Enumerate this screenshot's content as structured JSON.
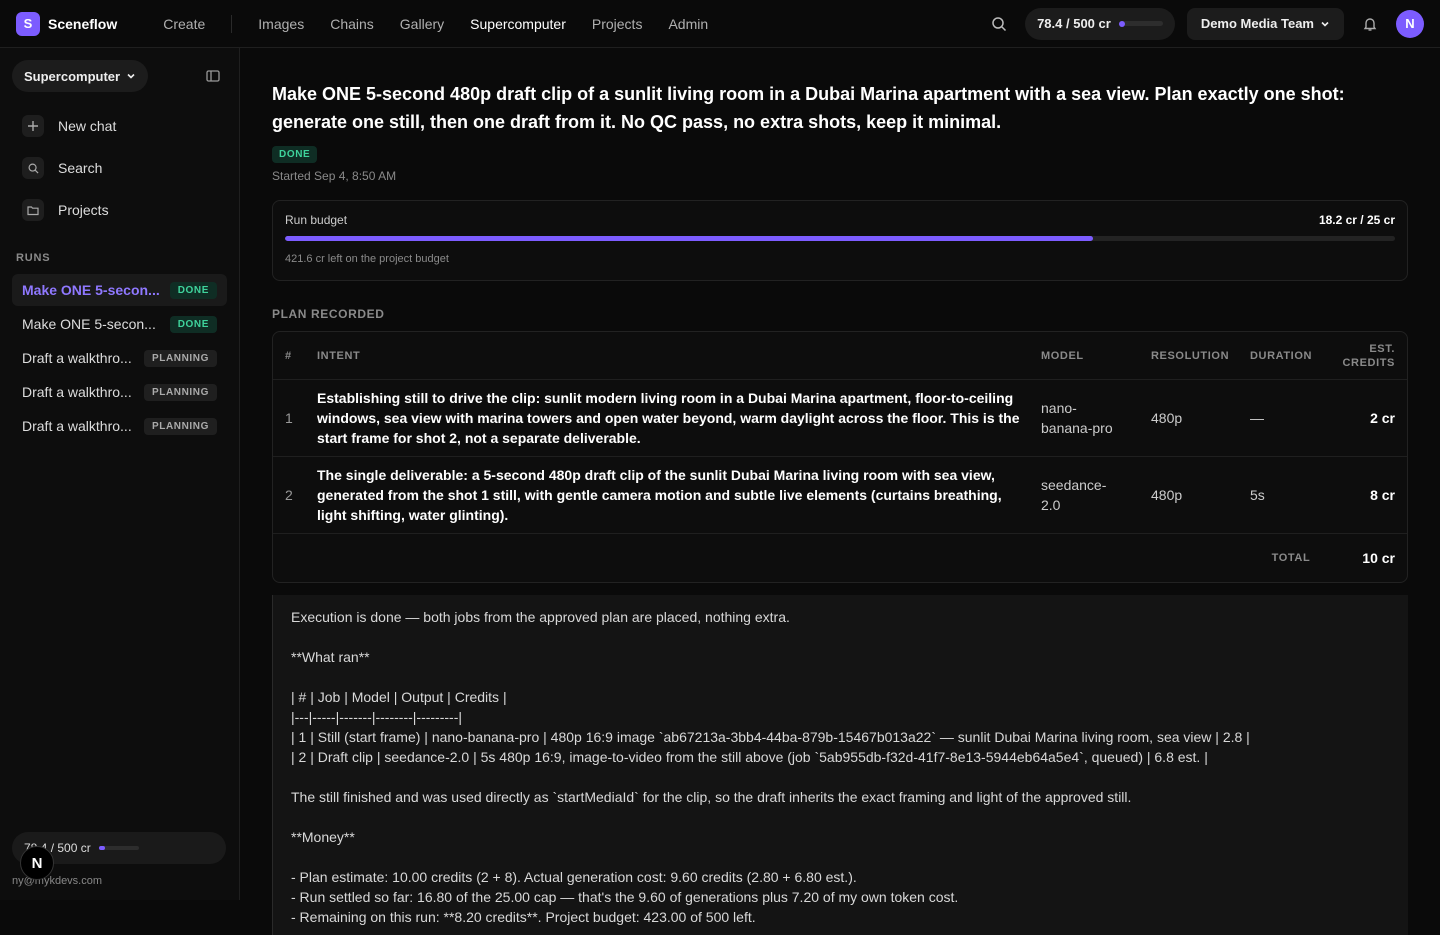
{
  "app": {
    "logo_letter": "S",
    "name": "Sceneflow"
  },
  "topnav": {
    "create": "Create",
    "items": [
      {
        "label": "Images",
        "active": false
      },
      {
        "label": "Chains",
        "active": false
      },
      {
        "label": "Gallery",
        "active": false
      },
      {
        "label": "Supercomputer",
        "active": true
      },
      {
        "label": "Projects",
        "active": false
      },
      {
        "label": "Admin",
        "active": false
      }
    ],
    "credits": "78.4 / 500 cr",
    "credits_fraction": 0.157,
    "team": "Demo Media Team",
    "avatar": "N"
  },
  "sidebar": {
    "dropdown": "Supercomputer",
    "menu": [
      {
        "label": "New chat",
        "icon": "plus-icon"
      },
      {
        "label": "Search",
        "icon": "search-icon"
      },
      {
        "label": "Projects",
        "icon": "folder-icon"
      }
    ],
    "runs_label": "RUNS",
    "runs": [
      {
        "title": "Make ONE 5-secon...",
        "status": "DONE",
        "active": true
      },
      {
        "title": "Make ONE 5-secon...",
        "status": "DONE",
        "active": false
      },
      {
        "title": "Draft a walkthro...",
        "status": "PLANNING",
        "active": false
      },
      {
        "title": "Draft a walkthro...",
        "status": "PLANNING",
        "active": false
      },
      {
        "title": "Draft a walkthro...",
        "status": "PLANNING",
        "active": false
      }
    ],
    "footer_credits": "78.4 / 500 cr",
    "footer_email": "ny@mykdevs.com",
    "fab_letter": "N"
  },
  "run": {
    "title": "Make ONE 5-second 480p draft clip of a sunlit living room in a Dubai Marina apartment with a sea view. Plan exactly one shot: generate one still, then one draft from it. No QC pass, no extra shots, keep it minimal.",
    "status": "DONE",
    "started": "Started Sep 4, 8:50 AM",
    "budget": {
      "label": "Run budget",
      "value": "18.2 cr / 25 cr",
      "fraction": 0.728,
      "note": "421.6 cr left on the project budget"
    },
    "plan_label": "PLAN RECORDED",
    "plan_headers": {
      "num": "#",
      "intent": "INTENT",
      "model": "MODEL",
      "resolution": "RESOLUTION",
      "duration": "DURATION",
      "credits": "EST. CREDITS"
    },
    "plan_rows": [
      {
        "num": "1",
        "intent": "Establishing still to drive the clip: sunlit modern living room in a Dubai Marina apartment, floor-to-ceiling windows, sea view with marina towers and open water beyond, warm daylight across the floor. This is the start frame for shot 2, not a separate deliverable.",
        "model": "nano-banana-pro",
        "resolution": "480p",
        "duration": "—",
        "credits": "2 cr"
      },
      {
        "num": "2",
        "intent": "The single deliverable: a 5-second 480p draft clip of the sunlit Dubai Marina living room with sea view, generated from the shot 1 still, with gentle camera motion and subtle live elements (curtains breathing, light shifting, water glinting).",
        "model": "seedance-2.0",
        "resolution": "480p",
        "duration": "5s",
        "credits": "8 cr"
      }
    ],
    "total_label": "TOTAL",
    "total_value": "10 cr",
    "message_lines": [
      "Execution is done — both jobs from the approved plan are placed, nothing extra.",
      "",
      "**What ran**",
      "",
      "| # | Job | Model | Output | Credits |",
      "|---|-----|-------|--------|---------|",
      "| 1 | Still (start frame) | nano-banana-pro | 480p 16:9 image `ab67213a-3bb4-44ba-879b-15467b013a22` — sunlit Dubai Marina living room, sea view | 2.8 |",
      "| 2 | Draft clip | seedance-2.0 | 5s 480p 16:9, image-to-video from the still above (job `5ab955db-f32d-41f7-8e13-5944eb64a5e4`, queued) | 6.8 est. |",
      "",
      "The still finished and was used directly as `startMediaId` for the clip, so the draft inherits the exact framing and light of the approved still.",
      "",
      "**Money**",
      "",
      "- Plan estimate: 10.00 credits (2 + 8). Actual generation cost: 9.60 credits (2.80 + 6.80 est.).",
      "- Run settled so far: 16.80 of the 25.00 cap — that's the 9.60 of generations plus 7.20 of my own token cost.",
      "- Remaining on this run: **8.20 credits**. Project budget: 423.00 of 500 left."
    ]
  }
}
